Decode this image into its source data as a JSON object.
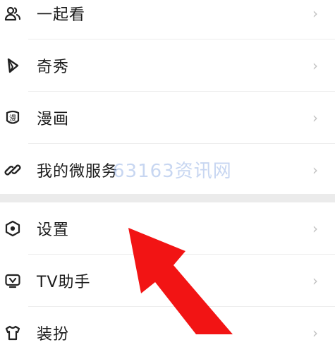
{
  "menu_top": [
    {
      "label": "一起看",
      "icon": "people-icon"
    },
    {
      "label": "奇秀",
      "icon": "play-triangle-icon"
    },
    {
      "label": "漫画",
      "icon": "comic-manga-icon"
    },
    {
      "label": "我的微服务",
      "icon": "link-chain-icon"
    }
  ],
  "menu_bottom": [
    {
      "label": "设置",
      "icon": "settings-hexagon-icon"
    },
    {
      "label": "TV助手",
      "icon": "tv-icon"
    },
    {
      "label": "装扮",
      "icon": "dress-up-shirt-icon"
    }
  ],
  "chevron": "›",
  "watermark": "63163资讯网",
  "arrow_color": "#f21414"
}
